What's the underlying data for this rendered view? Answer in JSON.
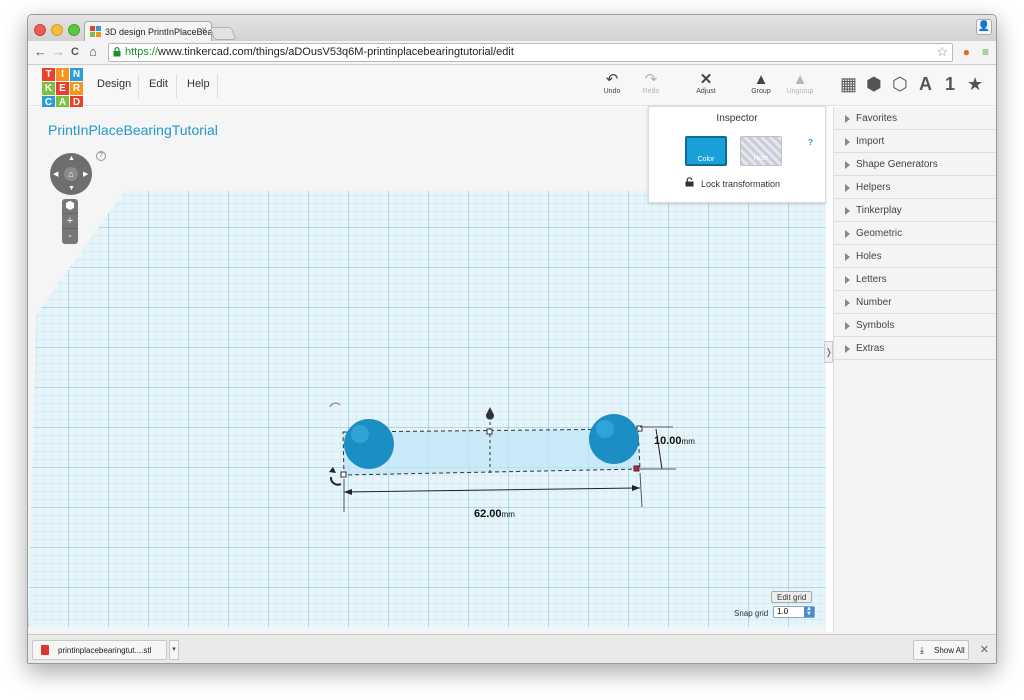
{
  "browser": {
    "tab_title": "3D design PrintInPlaceBea",
    "tab_close": "×",
    "url_scheme": "https://",
    "url_rest": "www.tinkercad.com/things/aDOusV53q6M-printinplacebearingtutorial/edit",
    "nav": {
      "back": "←",
      "forward": "→",
      "reload": "C",
      "home": "⌂"
    },
    "star": "☆",
    "extension_icons": [
      "flame-icon",
      "menu-icon"
    ]
  },
  "app": {
    "logo_letters": [
      [
        "T",
        "I",
        "N"
      ],
      [
        "K",
        "E",
        "R"
      ],
      [
        "C",
        "A",
        "D"
      ]
    ],
    "logo_colors": [
      "#e8402c",
      "#f7941d",
      "#2f9bd8",
      "#7ac043",
      "#e8402c",
      "#f7941d",
      "#2f9bd8",
      "#7ac043",
      "#e8402c"
    ],
    "menu": [
      "Design",
      "Edit",
      "Help"
    ],
    "tools": [
      {
        "label": "Undo",
        "icon": "↶",
        "enabled": true
      },
      {
        "label": "Redo",
        "icon": "↷",
        "enabled": false
      },
      {
        "label": "Adjust",
        "icon": "✕",
        "enabled": true
      },
      {
        "label": "Group",
        "icon": "▲",
        "enabled": true
      },
      {
        "label": "Ungroup",
        "icon": "▲",
        "enabled": false
      }
    ],
    "view_icons": [
      "▦",
      "⬢",
      "⬡",
      "A",
      "1",
      "★"
    ]
  },
  "canvas": {
    "design_title": "PrintInPlaceBearingTutorial",
    "help_mark": "?",
    "zoom_in": "+",
    "zoom_out": "-",
    "dimension_length": "62.00",
    "dimension_width": "10.00",
    "dimension_unit": "mm",
    "edit_grid_label": "Edit grid",
    "snap_grid_label": "Snap grid",
    "snap_grid_value": "1.0"
  },
  "inspector": {
    "title": "Inspector",
    "color_label": "Color",
    "hole_label": "Hole",
    "help_mark": "?",
    "lock_label": "Lock transformation",
    "selected_color": "#1aa0d8"
  },
  "panel": {
    "collapse_glyph": "❭",
    "categories": [
      "Favorites",
      "Import",
      "Shape Generators",
      "Helpers",
      "Tinkerplay",
      "Geometric",
      "Holes",
      "Letters",
      "Number",
      "Symbols",
      "Extras"
    ]
  },
  "downloads": {
    "file_name": "printinplacebearingtut....stl",
    "menu_arrow": "▾",
    "show_all": "Show All",
    "close": "✕"
  }
}
